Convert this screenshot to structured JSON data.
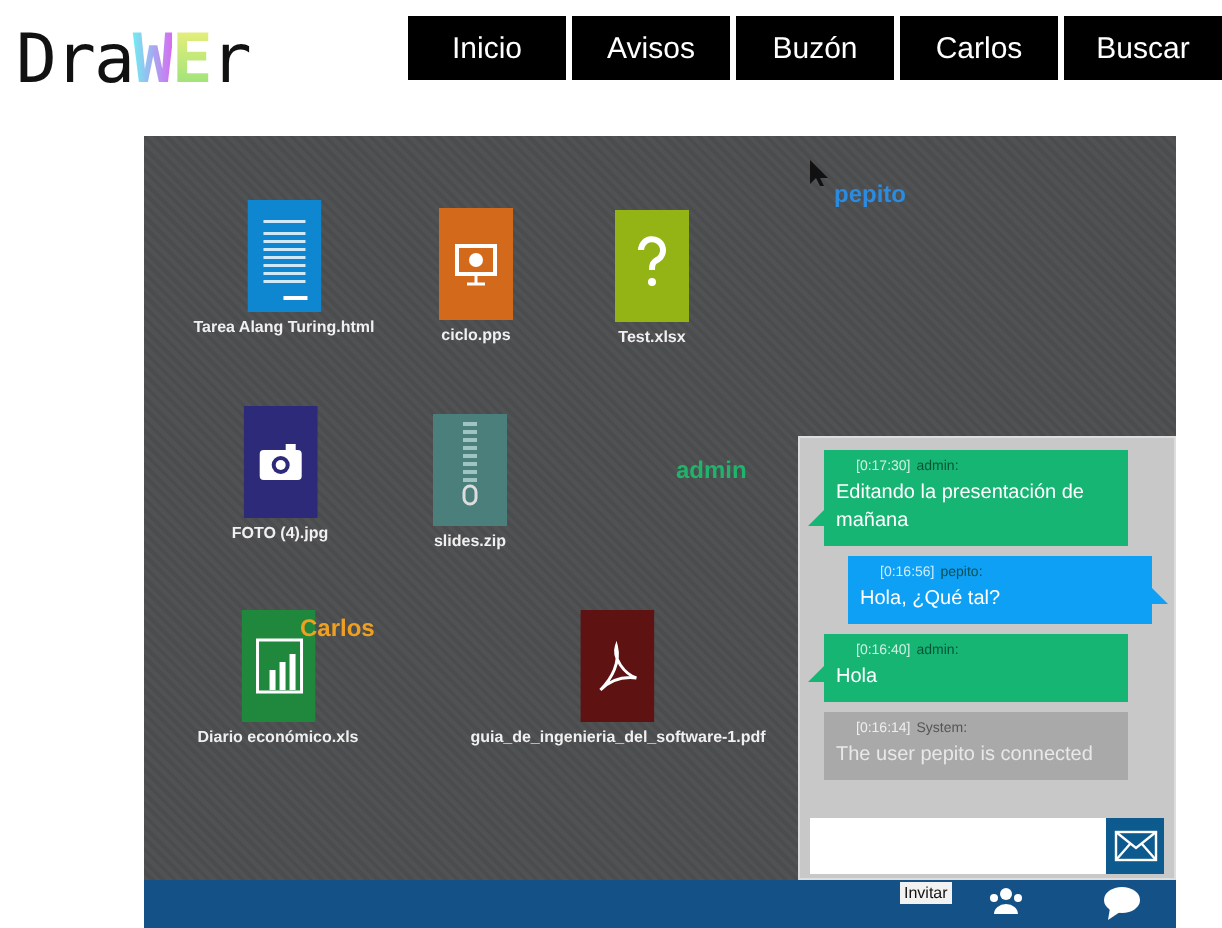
{
  "logo": [
    {
      "text": "Dra",
      "kind": "plain"
    },
    {
      "text": "W",
      "kind": "accent"
    },
    {
      "text": "E",
      "kind": "accent"
    },
    {
      "text": "r",
      "kind": "plain"
    }
  ],
  "nav": [
    "Inicio",
    "Avisos",
    "Buzón",
    "Carlos",
    "Buscar"
  ],
  "files": [
    {
      "name": "Tarea Alang Turing.html",
      "kind": "doc"
    },
    {
      "name": "ciclo.pps",
      "kind": "slides"
    },
    {
      "name": "Test.xlsx",
      "kind": "unknown"
    },
    {
      "name": "FOTO (4).jpg",
      "kind": "photo"
    },
    {
      "name": "slides.zip",
      "kind": "zip"
    },
    {
      "name": "Diario económico.xls",
      "kind": "sheet"
    },
    {
      "name": "guia_de_ingenieria_del_software-1.pdf",
      "kind": "pdf"
    }
  ],
  "cursors": [
    {
      "name": "pepito",
      "color": "#2a8be0",
      "pointer": true
    },
    {
      "name": "admin",
      "color": "#1fb36b",
      "pointer": false
    },
    {
      "name": "Carlos",
      "color": "#f0a020",
      "pointer": false
    }
  ],
  "chat": {
    "messages": [
      {
        "time": "[0:17:30]",
        "user": "admin:",
        "text": "Editando la presentación de mañana",
        "kind": "incoming"
      },
      {
        "time": "[0:16:56]",
        "user": "pepito:",
        "text": "Hola, ¿Qué tal?",
        "kind": "outgoing"
      },
      {
        "time": "[0:16:40]",
        "user": "admin:",
        "text": "Hola",
        "kind": "incoming"
      },
      {
        "time": "[0:16:14]",
        "user": "System:",
        "text": "The user  pepito  is connected",
        "kind": "system"
      }
    ]
  },
  "bottom_bar": {
    "tooltip": "Invitar"
  }
}
